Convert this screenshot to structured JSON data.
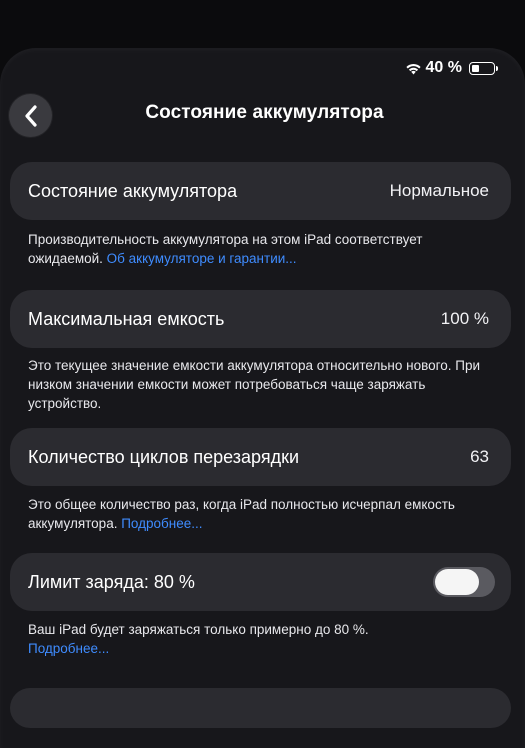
{
  "status_bar": {
    "battery_percent": "40 %",
    "battery_level": 0.4
  },
  "nav": {
    "title": "Состояние аккумулятора"
  },
  "rows": {
    "battery_health": {
      "label": "Состояние аккумулятора",
      "value": "Нормальное",
      "note_text": "Производительность аккумулятора на этом iPad соответствует ожидаемой.",
      "note_link": "Об аккумуляторе и гарантии..."
    },
    "max_capacity": {
      "label": "Максимальная емкость",
      "value": "100 %",
      "note_text": "Это текущее значение емкости аккумулятора относительно нового. При низком значении емкости может потребоваться чаще заряжать устройство."
    },
    "cycle_count": {
      "label": "Количество циклов перезарядки",
      "value": "63",
      "note_text": "Это общее количество раз, когда iPad полностью исчерпал емкость аккумулятора.",
      "note_link": "Подробнее..."
    },
    "charge_limit": {
      "label": "Лимит заряда: 80 %",
      "toggle_on": false,
      "note_text": "Ваш iPad будет заряжаться только примерно до 80 %.",
      "note_link": "Подробнее..."
    }
  }
}
